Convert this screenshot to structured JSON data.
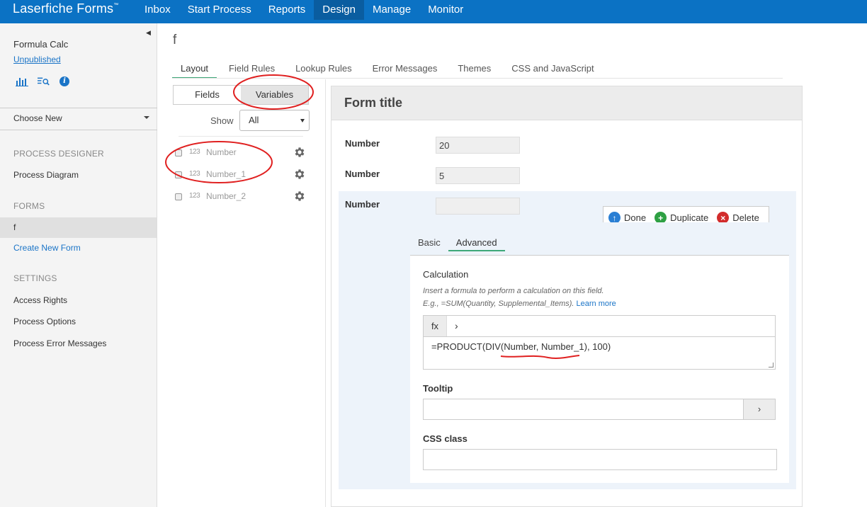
{
  "topbar": {
    "brand": "Laserfiche Forms",
    "brand_mark": "™",
    "nav": [
      "Inbox",
      "Start Process",
      "Reports",
      "Design",
      "Manage",
      "Monitor"
    ],
    "active_nav": "Design"
  },
  "sidebar": {
    "process_name": "Formula Calc",
    "status": "Unpublished",
    "choose_new": "Choose New",
    "process_designer_heading": "PROCESS DESIGNER",
    "process_diagram": "Process Diagram",
    "forms_heading": "FORMS",
    "form_item": "f",
    "create_new_form": "Create New Form",
    "settings_heading": "SETTINGS",
    "access_rights": "Access Rights",
    "process_options": "Process Options",
    "process_error_messages": "Process Error Messages"
  },
  "main": {
    "form_name": "f",
    "tabs": [
      "Layout",
      "Field Rules",
      "Lookup Rules",
      "Error Messages",
      "Themes",
      "CSS and JavaScript"
    ]
  },
  "panel": {
    "fields_btn": "Fields",
    "variables_btn": "Variables",
    "show_label": "Show",
    "show_value": "All",
    "type_glyph": "123",
    "variables": [
      "Number",
      "Number_1",
      "Number_2"
    ]
  },
  "canvas": {
    "form_title": "Form title",
    "fields": [
      {
        "label": "Number",
        "value": "20"
      },
      {
        "label": "Number",
        "value": "5"
      },
      {
        "label": "Number",
        "value": ""
      }
    ],
    "actions": {
      "done": "Done",
      "duplicate": "Duplicate",
      "delete": "Delete"
    }
  },
  "editor": {
    "tabs": [
      "Basic",
      "Advanced"
    ],
    "active_tab": "Advanced",
    "calc_title": "Calculation",
    "help_line1": "Insert a formula to perform a calculation on this field.",
    "help_line2": "E.g., =SUM(Quantity, Supplemental_Items).",
    "learn_more": "Learn more",
    "fx": "fx",
    "formula": "=PRODUCT(DIV(Number, Number_1), 100)",
    "tooltip_label": "Tooltip",
    "css_label": "CSS class"
  },
  "colors": {
    "topbar": "#0b72c4",
    "nav_active": "#0a5da0",
    "accent": "#3ea879",
    "link": "#1a74c7",
    "annotation": "#e02020"
  }
}
